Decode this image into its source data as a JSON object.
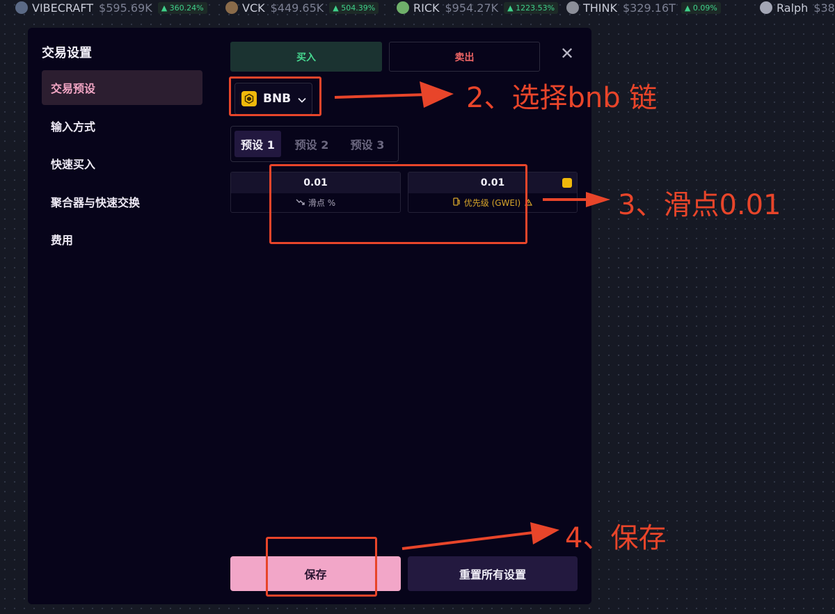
{
  "ticker": [
    {
      "name": "VIBECRAFT",
      "price": "$595.69K",
      "change": "▲ 360.24%",
      "logo_color": "#5b6a86"
    },
    {
      "name": "VCK",
      "price": "$449.65K",
      "change": "▲ 504.39%",
      "logo_color": "#8a6b4a"
    },
    {
      "name": "RICK",
      "price": "$954.27K",
      "change": "▲ 1223.53%",
      "logo_color": "#6fb06a"
    },
    {
      "name": "THINK",
      "price": "$329.16T",
      "change": "▲ 0.09%",
      "logo_color": "#8c8f99"
    },
    {
      "name": "Ralph",
      "price": "$38",
      "change": "",
      "logo_color": "#a3a6b5"
    }
  ],
  "sidebar": {
    "title": "交易设置",
    "items": [
      {
        "label": "交易预设",
        "active": true
      },
      {
        "label": "输入方式",
        "active": false
      },
      {
        "label": "快速买入",
        "active": false
      },
      {
        "label": "聚合器与快速交换",
        "active": false
      },
      {
        "label": "费用",
        "active": false
      }
    ]
  },
  "trade": {
    "buy_label": "买入",
    "sell_label": "卖出",
    "close_icon": "close-icon",
    "chain": {
      "label": "BNB",
      "icon": "bnb-logo"
    },
    "presets": [
      "预设 1",
      "预设 2",
      "预设 3"
    ],
    "active_preset": 0,
    "slippage": {
      "value": "0.01",
      "label": "滑点 %"
    },
    "priority": {
      "value": "0.01",
      "label": "优先级 (GWEI)"
    },
    "save_label": "保存",
    "reset_label": "重置所有设置"
  },
  "annotations": {
    "step2": "2、选择bnb 链",
    "step3": "3、滑点0.01",
    "step4": "4、保存"
  },
  "colors": {
    "accent_pink": "#f2a6c8",
    "buy_green": "#46d68f",
    "sell_red": "#ef6565",
    "annotation_red": "#e8452a",
    "bnb_gold": "#f0b90b"
  }
}
